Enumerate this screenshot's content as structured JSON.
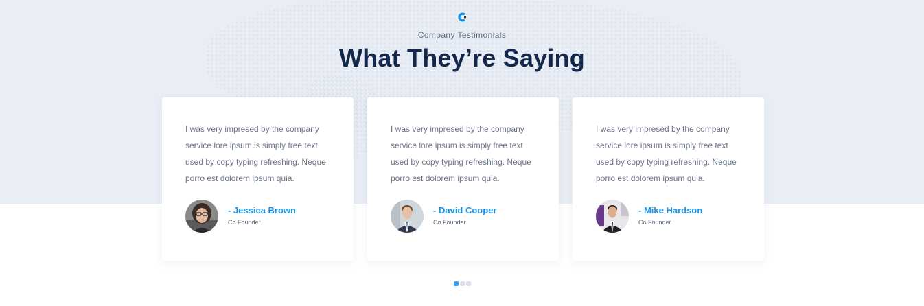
{
  "header": {
    "eyebrow": "Company Testimonials",
    "title": "What They’re Saying"
  },
  "colors": {
    "accent": "#1a94e8",
    "heading": "#14284b",
    "band_bg": "#e9eef6"
  },
  "testimonials": [
    {
      "quote": "I was very impresed by the company service lore ipsum is simply free text used by copy typing refreshing. Neque porro est dolorem ipsum quia.",
      "name": "- Jessica Brown",
      "role": "Co Founder",
      "avatar": "woman-portrait"
    },
    {
      "quote": "I was very impresed by the company service lore ipsum is simply free text used by copy typing refreshing. Neque porro est dolorem ipsum quia.",
      "name": "- David Cooper",
      "role": "Co Founder",
      "avatar": "man-suit-portrait"
    },
    {
      "quote": "I was very impresed by the company service lore ipsum is simply free text used by copy typing refreshing. Neque porro est dolorem ipsum quia.",
      "name": "- Mike Hardson",
      "role": "Co Founder",
      "avatar": "man-office-portrait"
    }
  ],
  "carousel": {
    "total_pages": 3,
    "active_page": 1
  }
}
